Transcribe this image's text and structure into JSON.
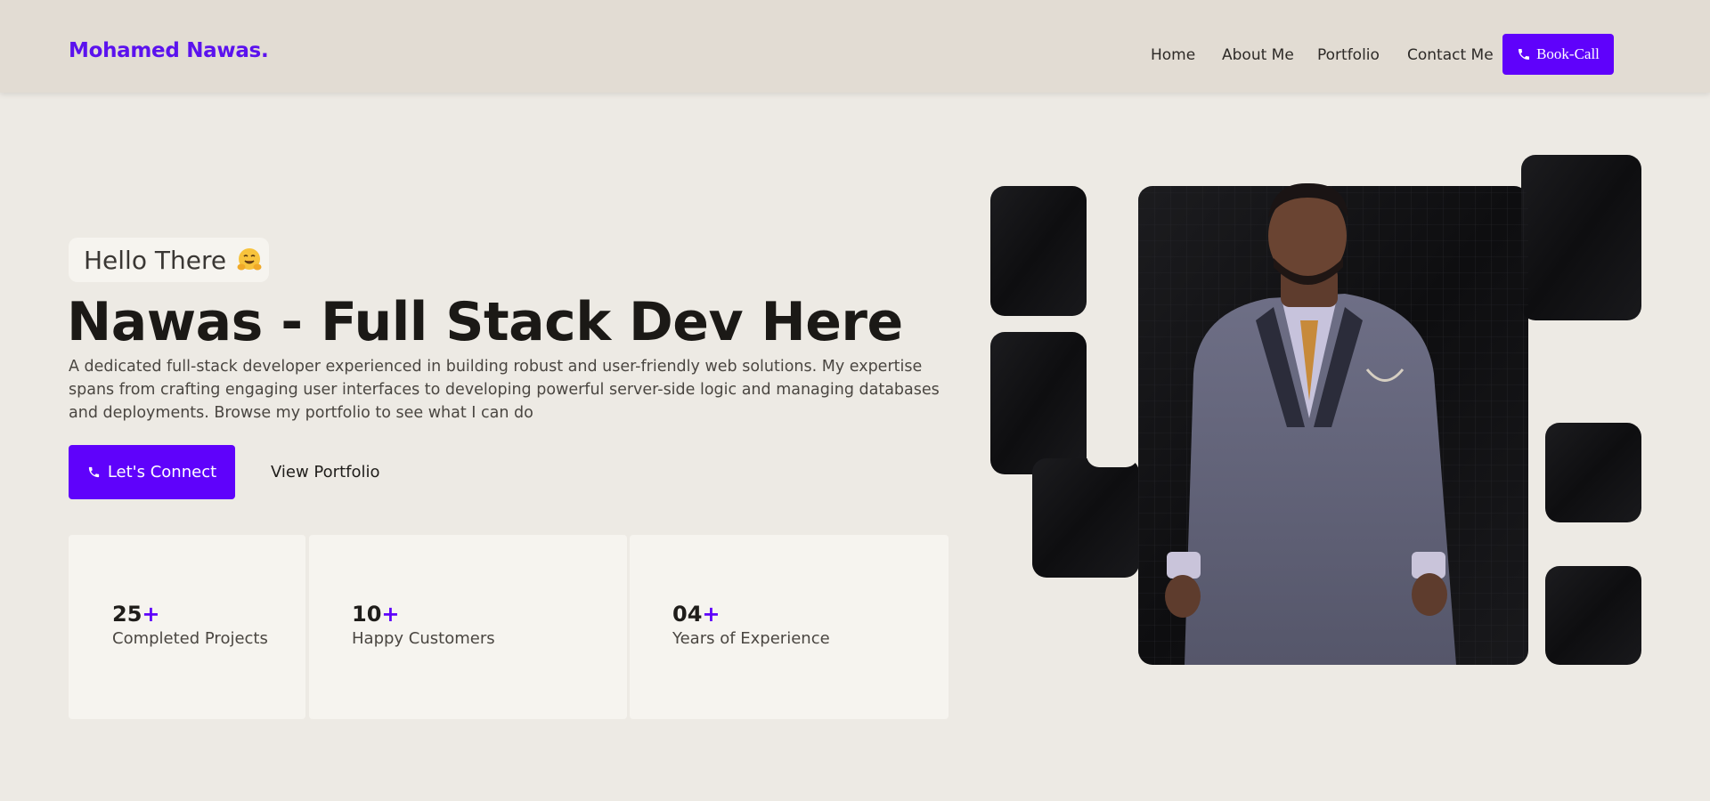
{
  "header": {
    "logo": "Mohamed Nawas.",
    "nav": [
      "Home",
      "About Me",
      "Portfolio",
      "Contact Me"
    ],
    "book_label": "Book-Call"
  },
  "hero": {
    "greeting": "Hello There",
    "greeting_emoji": "hugging-face-icon",
    "title": "Nawas - Full Stack Dev Here",
    "description": "A dedicated full-stack developer experienced in building robust and user-friendly web solutions. My expertise spans from crafting engaging user interfaces to developing powerful server-side logic and managing databases and deployments. Browse my portfolio to see what I can do",
    "connect_label": "Let's Connect",
    "portfolio_label": "View Portfolio"
  },
  "stats": [
    {
      "value": "25",
      "suffix": "+",
      "label": "Completed Projects"
    },
    {
      "value": "10",
      "suffix": "+",
      "label": "Happy Customers"
    },
    {
      "value": "04",
      "suffix": "+",
      "label": "Years of Experience"
    }
  ],
  "colors": {
    "accent": "#5f02fb",
    "header_bg": "#e2dcd3",
    "page_bg": "#edeae4",
    "card_bg": "#f6f4ef"
  }
}
